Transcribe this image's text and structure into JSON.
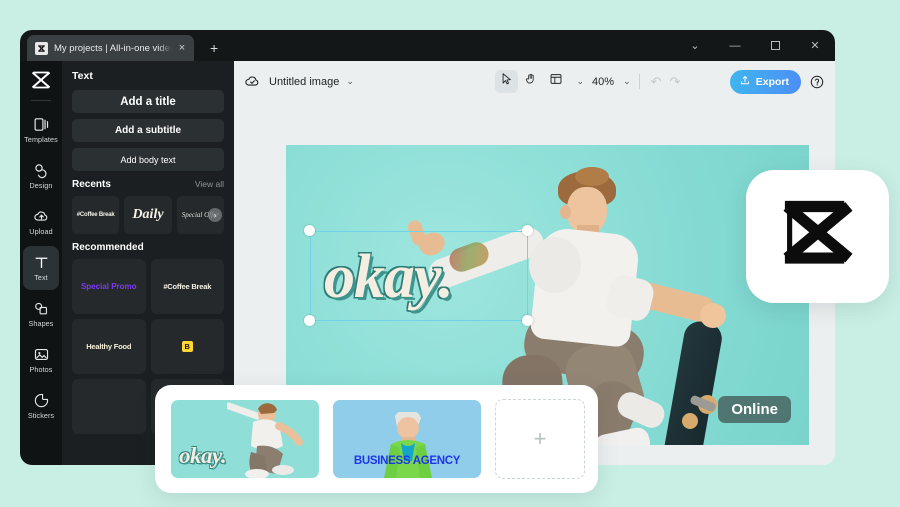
{
  "theme": {
    "page_background": "#c9efe4",
    "app_background": "#eceff0",
    "panel_background": "#1b1f21",
    "rail_background": "#101314",
    "titlebar_background": "#141718",
    "canvas_background": "#8fdfd8",
    "accent_export_from": "#3fb6f0",
    "accent_export_to": "#4d8df4",
    "selection_outline": "#6fd4e8",
    "badge_background": "rgba(63,80,77,.72)",
    "special_promo_color": "#7b3cf0",
    "business_agency_color": "#1f36e8",
    "okay_text_fill": "#f3eee1",
    "okay_text_shadow": "#3f948e"
  },
  "titlebar": {
    "tab": {
      "title": "My projects | All-in-one video",
      "favicon": "capcut-icon",
      "close": "×"
    },
    "new_tab": "+",
    "window_controls": [
      {
        "name": "tab-search-button",
        "glyph": "⌄"
      },
      {
        "name": "minimize-button",
        "glyph": "—"
      },
      {
        "name": "maximize-button",
        "glyph": "☐"
      },
      {
        "name": "close-button",
        "glyph": "✕"
      }
    ]
  },
  "rail": {
    "logo": "capcut-logo-icon",
    "items": [
      {
        "label": "Templates",
        "icon": "templates-icon",
        "active": false
      },
      {
        "label": "Design",
        "icon": "design-icon",
        "active": false
      },
      {
        "label": "Upload",
        "icon": "upload-icon",
        "active": false
      },
      {
        "label": "Text",
        "icon": "text-icon",
        "active": true
      },
      {
        "label": "Shapes",
        "icon": "shapes-icon",
        "active": false
      },
      {
        "label": "Photos",
        "icon": "photos-icon",
        "active": false
      },
      {
        "label": "Stickers",
        "icon": "stickers-icon",
        "active": false
      }
    ]
  },
  "panel": {
    "heading": "Text",
    "buttons": [
      {
        "label": "Add a title"
      },
      {
        "label": "Add a subtitle"
      },
      {
        "label": "Add body text"
      }
    ],
    "recents": {
      "heading": "Recents",
      "view_all": "View all",
      "next_arrow": "›",
      "tiles": [
        {
          "label": "#Coffee Break"
        },
        {
          "label": "Daily"
        },
        {
          "label": "Special Offer"
        }
      ]
    },
    "recommended": {
      "heading": "Recommended",
      "tiles": [
        {
          "label": "Special Promo"
        },
        {
          "label": "#Coffee Break"
        },
        {
          "label": "Healthy Food"
        },
        {
          "label": "B"
        }
      ]
    }
  },
  "toolbar": {
    "cloud_icon": "cloud-saved-icon",
    "document_title": "Untitled image",
    "title_caret": "⌄",
    "tools": [
      {
        "name": "select-tool",
        "icon": "cursor-arrow-icon",
        "selected": true
      },
      {
        "name": "hand-tool",
        "icon": "hand-icon",
        "selected": false
      },
      {
        "name": "layout-tool",
        "icon": "layout-panel-icon",
        "selected": false
      }
    ],
    "layout_caret": "⌄",
    "zoom_level": "40%",
    "zoom_caret": "⌄",
    "undo": "↶",
    "redo": "↷",
    "export_label": "Export",
    "export_icon": "upload-share-icon",
    "help_icon": "help-circle-icon"
  },
  "canvas": {
    "text_layer": "okay.",
    "online_badge": "Online",
    "selection_handles": 4
  },
  "logo_badge": {
    "name": "capcut-logo-icon"
  },
  "filmstrip": {
    "items": [
      {
        "name": "page-thumbnail-1",
        "label": "okay.",
        "selected": true
      },
      {
        "name": "page-thumbnail-2",
        "label": "BUSINESS AGENCY",
        "selected": false
      }
    ],
    "add_page": "+"
  }
}
